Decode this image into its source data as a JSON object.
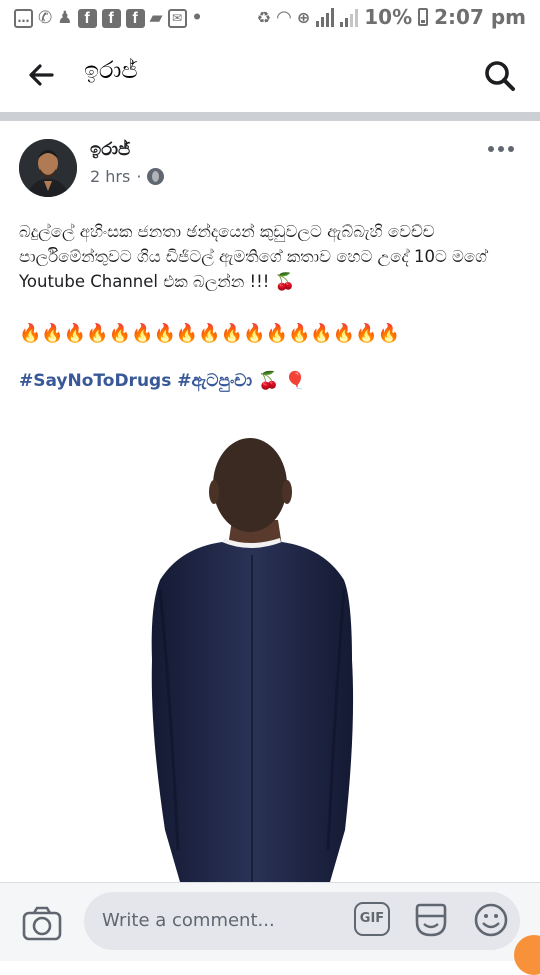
{
  "status_bar": {
    "battery_text": "10%",
    "time": "2:07 pm"
  },
  "header": {
    "title": "ඉරාජ්"
  },
  "post": {
    "author": "ඉරාජ්",
    "time_ago": "2 hrs",
    "separator": "·",
    "text": "බදුල්ලේ අහිංසක ජනතා ඡන්දයෙන් කුඩුවලට ඇබ්බැහි වෙච්ච පාර්ලිමේන්තුවට ගිය ඩිජිටල් ඇමතිගේ කතාව හෙට උදේ 10ට මගේ Youtube Channel එක බලන්න !!! 🍒",
    "fire_row": "🔥🔥🔥🔥🔥🔥🔥🔥🔥🔥🔥🔥🔥🔥🔥🔥🔥",
    "hashtags": "#SayNoToDrugs #ඇටපුංචා",
    "hashtag_emoji": "🍒 🎈"
  },
  "comment_bar": {
    "placeholder": "Write a comment...",
    "gif_label": "GIF"
  },
  "colors": {
    "link": "#385898",
    "divider": "#ccd0d5",
    "accent_orange": "#f7923a"
  }
}
